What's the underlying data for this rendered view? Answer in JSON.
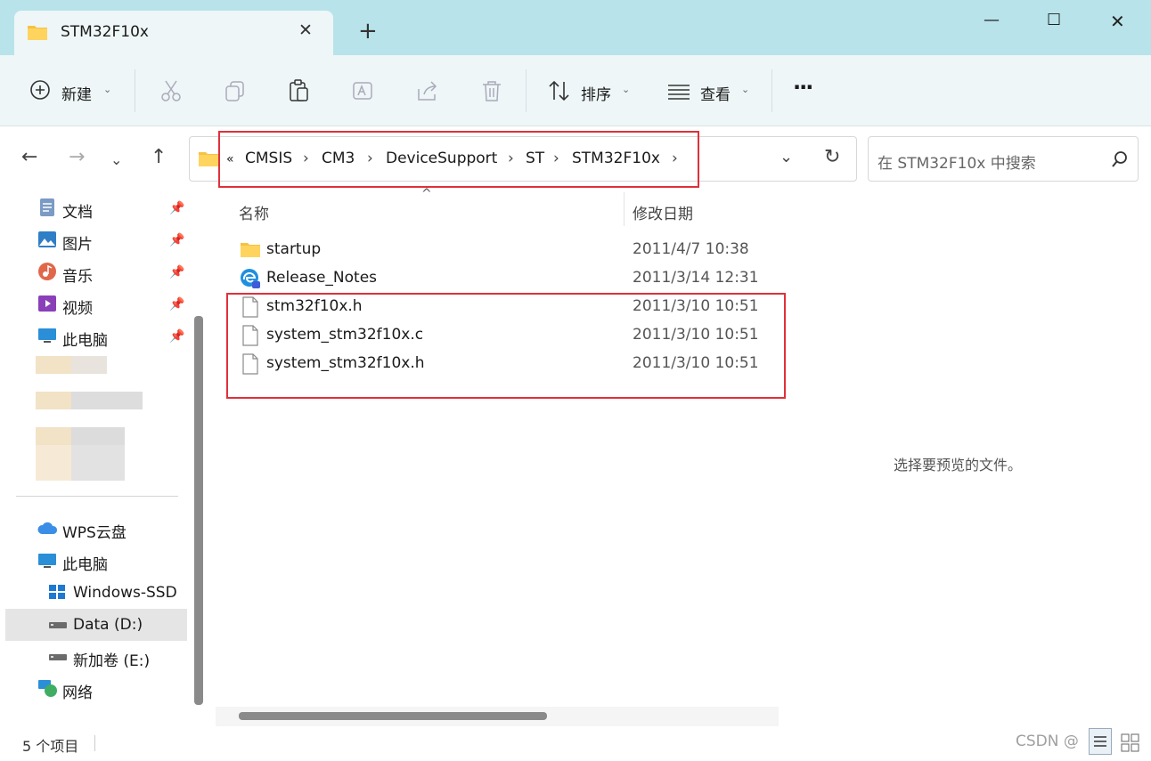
{
  "window": {
    "tab_title": "STM32F10x",
    "new_tab": "+",
    "minimize": "—",
    "maximize": "☐",
    "close": "✕"
  },
  "toolbar": {
    "new_label": "新建",
    "sort_label": "排序",
    "view_label": "查看",
    "more_label": "···"
  },
  "address": {
    "overflow": "«",
    "crumbs": [
      "CMSIS",
      "CM3",
      "DeviceSupport",
      "ST",
      "STM32F10x"
    ],
    "separator": "›"
  },
  "search": {
    "placeholder": "在 STM32F10x 中搜索"
  },
  "nav": {
    "quick": [
      {
        "label": "文档"
      },
      {
        "label": "图片"
      },
      {
        "label": "音乐"
      },
      {
        "label": "视频"
      },
      {
        "label": "此电脑"
      }
    ],
    "tree": [
      {
        "label": "WPS云盘"
      },
      {
        "label": "此电脑"
      },
      {
        "label": "Windows-SSD"
      },
      {
        "label": "Data (D:)"
      },
      {
        "label": "新加卷 (E:)"
      },
      {
        "label": "网络"
      }
    ]
  },
  "columns": {
    "name": "名称",
    "modified": "修改日期"
  },
  "files": [
    {
      "name": "startup",
      "date": "2011/4/7 10:38",
      "icon": "folder-icon"
    },
    {
      "name": "Release_Notes",
      "date": "2011/3/14 12:31",
      "icon": "edge-html-icon"
    },
    {
      "name": "stm32f10x.h",
      "date": "2011/3/10 10:51",
      "icon": "file-icon"
    },
    {
      "name": "system_stm32f10x.c",
      "date": "2011/3/10 10:51",
      "icon": "file-icon"
    },
    {
      "name": "system_stm32f10x.h",
      "date": "2011/3/10 10:51",
      "icon": "file-icon"
    }
  ],
  "preview": {
    "text": "选择要预览的文件。"
  },
  "status": {
    "item_count": "5 个项目"
  },
  "watermark": "CSDN @",
  "colors": {
    "accent": "#b8e3ea",
    "highlight": "#e0303a",
    "selected": "#e5e5e5"
  }
}
